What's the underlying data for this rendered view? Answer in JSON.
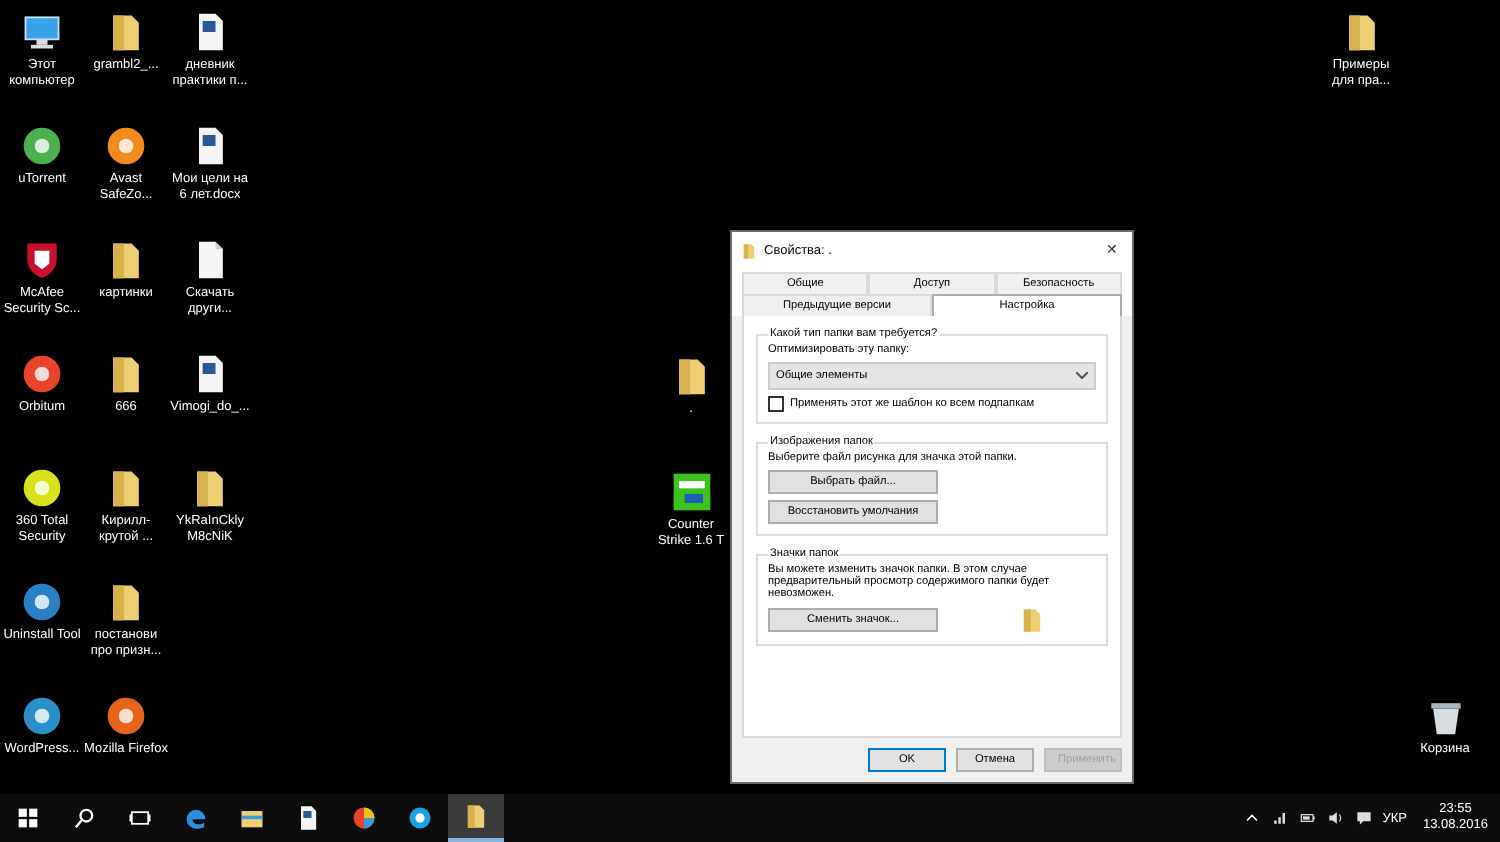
{
  "desktop": {
    "columns": [
      [
        {
          "kind": "computer",
          "label": "Этот компьютер"
        },
        {
          "kind": "app",
          "color": "#4caf50",
          "label": "uTorrent"
        },
        {
          "kind": "shield",
          "color": "#c8102e",
          "label": "McAfee Security Sc..."
        },
        {
          "kind": "app",
          "color": "#e8442c",
          "label": "Orbitum"
        },
        {
          "kind": "app",
          "color": "#d6e21c",
          "label": "360 Total Security"
        },
        {
          "kind": "app",
          "color": "#2b7fc4",
          "label": "Uninstall Tool"
        },
        {
          "kind": "app",
          "color": "#2a8fc8",
          "label": "WordPress..."
        }
      ],
      [
        {
          "kind": "folder",
          "label": "grambl2_..."
        },
        {
          "kind": "app",
          "color": "#f28a1c",
          "label": "Avast SafeZo..."
        },
        {
          "kind": "folder",
          "label": "картинки"
        },
        {
          "kind": "folder",
          "label": "666"
        },
        {
          "kind": "folder",
          "label": "Кирилл-крутой ..."
        },
        {
          "kind": "folder",
          "label": "постанови про призн..."
        },
        {
          "kind": "app",
          "color": "#e8641c",
          "label": "Mozilla Firefox"
        }
      ],
      [
        {
          "kind": "word",
          "label": "дневник практики п..."
        },
        {
          "kind": "word",
          "label": "Мои цели на 6 лет.docx"
        },
        {
          "kind": "document",
          "label": "Скачать други..."
        },
        {
          "kind": "word",
          "label": "Vimogi_do_..."
        },
        {
          "kind": "folder",
          "label": "YkRaInCkly M8cNiK"
        }
      ]
    ],
    "loose": [
      {
        "kind": "folder",
        "label": "."
      },
      {
        "kind": "game",
        "color": "#3cc41c",
        "label": "Counter Strike 1.6 T"
      },
      {
        "kind": "folder",
        "label": "Примеры для пра..."
      },
      {
        "kind": "trash",
        "label": "Корзина"
      }
    ]
  },
  "dialog": {
    "title": "Свойства: .",
    "close": "✕",
    "tabs": [
      [
        {
          "label": "Общие",
          "selected": false
        },
        {
          "label": "Доступ",
          "selected": false
        },
        {
          "label": "Безопасность",
          "selected": false
        }
      ],
      [
        {
          "label": "Предыдущие версии",
          "selected": false
        },
        {
          "label": "Настройка",
          "selected": true
        }
      ]
    ],
    "type_group": {
      "title": "Какой тип папки вам требуется?",
      "label": "Оптимизировать эту папку:",
      "dropdown": "Общие элементы",
      "checkbox": {
        "label": "Применять этот же шаблон ко всем подпапкам",
        "checked": false
      }
    },
    "pictures_group": {
      "title": "Изображения папок",
      "text": "Выберите файл рисунка для значка этой папки.",
      "buttons": [
        "Выбрать файл...",
        "Восстановить умолчания"
      ]
    },
    "icons_group": {
      "title": "Значки папок",
      "text": "Вы можете изменить значок папки. В этом случае предварительный просмотр содержимого папки будет невозможен.",
      "button": "Сменить значок..."
    },
    "buttons": [
      {
        "label": "OK",
        "disabled": false
      },
      {
        "label": "Отмена",
        "disabled": false
      },
      {
        "label": "Применить",
        "disabled": true
      }
    ]
  },
  "taskbar": {
    "apps": [
      {
        "kind": "start",
        "selected": false
      },
      {
        "kind": "search",
        "selected": false
      },
      {
        "kind": "taskview",
        "selected": false
      },
      {
        "kind": "edge",
        "selected": false
      },
      {
        "kind": "explorer",
        "selected": false
      },
      {
        "kind": "word",
        "selected": false
      },
      {
        "kind": "orbitum",
        "selected": false
      },
      {
        "kind": "skype",
        "selected": false
      },
      {
        "kind": "folder",
        "selected": true
      }
    ],
    "tray": {
      "icons": [
        {
          "kind": "chevron"
        },
        {
          "kind": "network"
        },
        {
          "kind": "battery"
        },
        {
          "kind": "volume"
        },
        {
          "kind": "notification"
        }
      ],
      "language": "УКР",
      "time": "23:55",
      "date": "13.08.2016"
    }
  }
}
